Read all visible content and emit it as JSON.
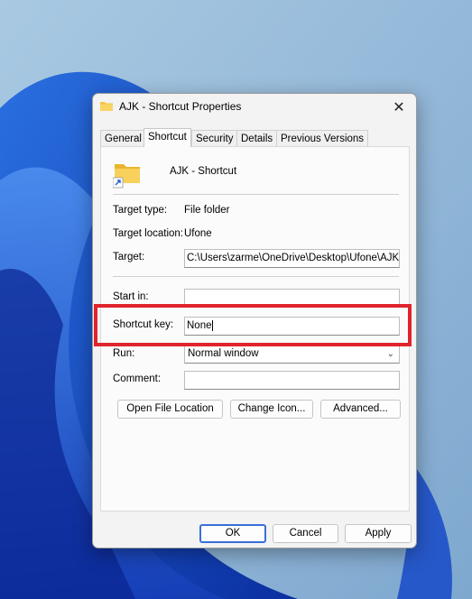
{
  "window": {
    "title": "AJK - Shortcut Properties"
  },
  "tabs": [
    "General",
    "Shortcut",
    "Security",
    "Details",
    "Previous Versions"
  ],
  "shortcut": {
    "name": "AJK - Shortcut",
    "target_type_label": "Target type:",
    "target_type_value": "File folder",
    "target_location_label": "Target location:",
    "target_location_value": "Ufone",
    "target_label": "Target:",
    "target_value": "C:\\Users\\zarme\\OneDrive\\Desktop\\Ufone\\AJK",
    "start_in_label": "Start in:",
    "start_in_value": "",
    "shortcut_key_label": "Shortcut key:",
    "shortcut_key_value": "None",
    "run_label": "Run:",
    "run_value": "Normal window",
    "comment_label": "Comment:",
    "comment_value": ""
  },
  "buttons": {
    "open_file_location": "Open File Location",
    "change_icon": "Change Icon...",
    "advanced": "Advanced...",
    "ok": "OK",
    "cancel": "Cancel",
    "apply": "Apply"
  },
  "colors": {
    "highlight": "#e0242c",
    "accent": "#3a6fd8",
    "folder": "#f4c43b"
  },
  "icons": {
    "title": "folder-icon",
    "shortcut": "folder-shortcut-icon",
    "close": "close-icon",
    "dropdown": "chevron-down-icon"
  }
}
